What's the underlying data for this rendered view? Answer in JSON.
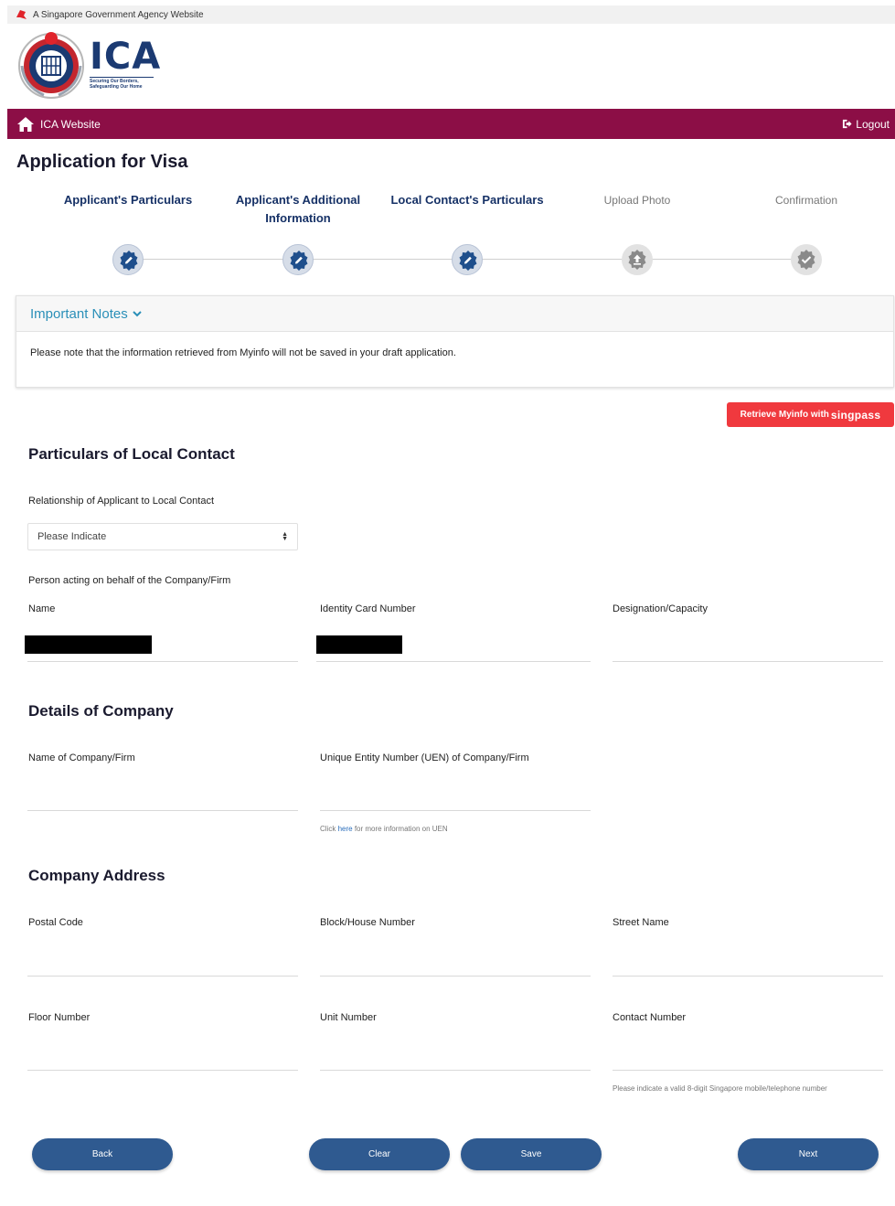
{
  "gov_banner": {
    "text": "A Singapore Government Agency Website",
    "lion_icon": "lion-head-icon"
  },
  "logo": {
    "name": "ICA",
    "tagline_line1": "Securing Our Borders,",
    "tagline_line2": "Safeguarding Our Home"
  },
  "navbar": {
    "home_label": "ICA Website",
    "logout_label": "Logout",
    "background": "#8c0e46"
  },
  "page_title": "Application for Visa",
  "steps": [
    {
      "line1": "Applicant's Particulars",
      "line2": "",
      "status": "completed"
    },
    {
      "line1": "Applicant's Additional",
      "line2": "Information",
      "status": "completed"
    },
    {
      "line1": "Local Contact's Particulars",
      "line2": "",
      "status": "completed"
    },
    {
      "line1": "Upload Photo",
      "line2": "",
      "status": "pending"
    },
    {
      "line1": "Confirmation",
      "line2": "",
      "status": "pending"
    }
  ],
  "notes": {
    "title": "Important Notes",
    "body": "Please note that the information retrieved from Myinfo will not be saved in your draft application."
  },
  "myinfo_button": {
    "prefix": "Retrieve Myinfo with",
    "brand": "singpass",
    "color": "#f0393e"
  },
  "local_contact": {
    "heading": "Particulars of Local Contact",
    "relationship_label": "Relationship of Applicant to Local Contact",
    "relationship_value": "Please Indicate",
    "person_label": "Person acting on behalf of the Company/Firm",
    "name_label": "Name",
    "id_label": "Identity Card Number",
    "designation_label": "Designation/Capacity"
  },
  "company": {
    "heading": "Details of Company",
    "name_label": "Name of Company/Firm",
    "uen_label": "Unique Entity Number (UEN) of Company/Firm",
    "uen_hint_prefix": "Click",
    "uen_hint_link": "here",
    "uen_hint_suffix": "for more information on UEN"
  },
  "address": {
    "heading": "Company Address",
    "postal_label": "Postal Code",
    "block_label": "Block/House Number",
    "street_label": "Street Name",
    "floor_label": "Floor Number",
    "unit_label": "Unit Number",
    "contact_label": "Contact Number",
    "contact_hint": "Please indicate a valid 8-digit Singapore mobile/telephone number"
  },
  "buttons": {
    "back": "Back",
    "clear": "Clear",
    "save": "Save",
    "next": "Next",
    "color": "#2f5a90"
  }
}
